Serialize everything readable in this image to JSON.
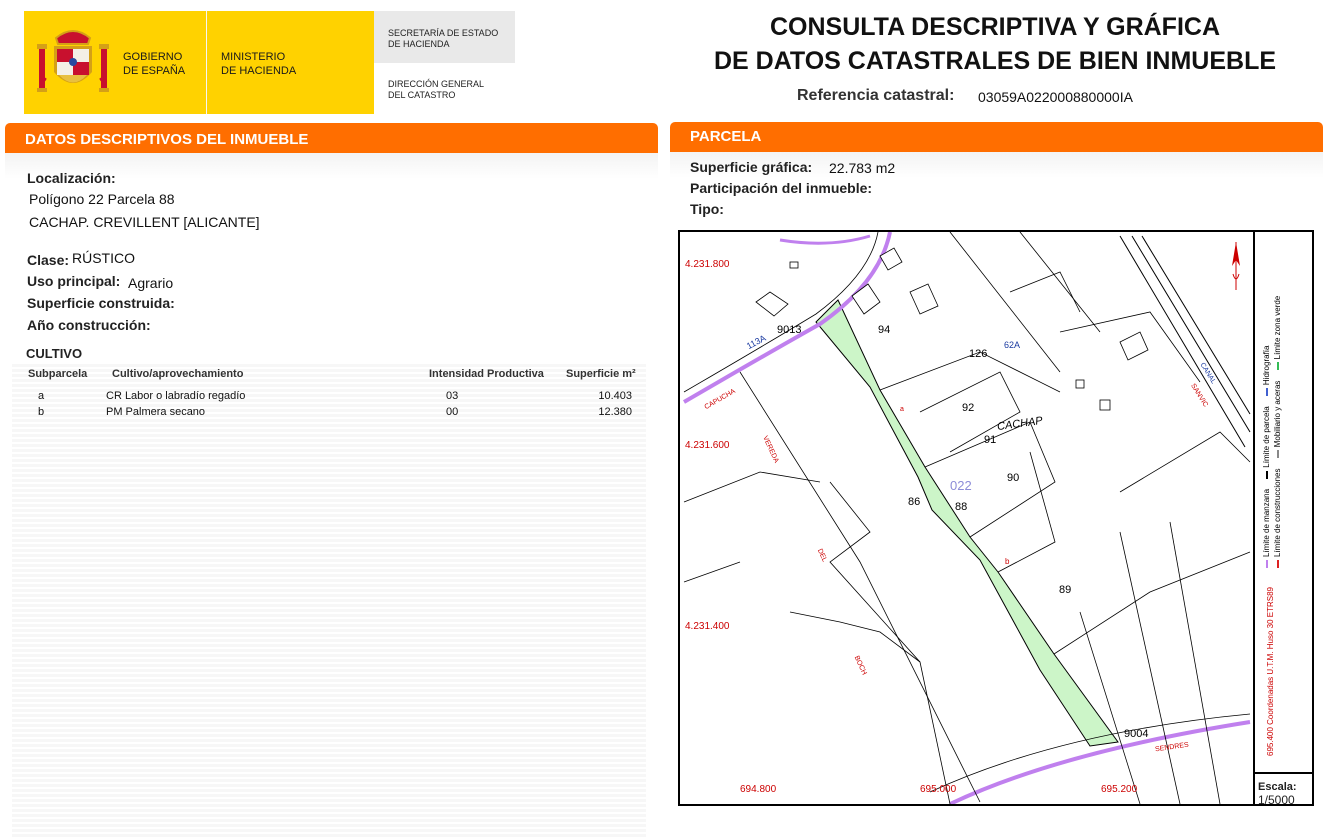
{
  "header": {
    "gobierno": [
      "GOBIERNO",
      "DE ESPAÑA"
    ],
    "ministerio": [
      "MINISTERIO",
      "DE HACIENDA"
    ],
    "secretaria": [
      "SECRETARÍA DE ESTADO",
      "DE HACIENDA"
    ],
    "direccion": [
      "DIRECCIÓN GENERAL",
      "DEL CATASTRO"
    ],
    "title_line1": "CONSULTA DESCRIPTIVA Y GRÁFICA",
    "title_line2": "DE DATOS CATASTRALES DE BIEN INMUEBLE",
    "ref_label": "Referencia catastral:",
    "ref_value": "03059A022000880000IA"
  },
  "colors": {
    "brand_yellow": "#ffd200",
    "accent_orange": "#ff6e00",
    "parcel_green": "#ccf5c8",
    "boundary_purple": "#c080ee"
  },
  "descriptive": {
    "section_title": "DATOS DESCRIPTIVOS DEL INMUEBLE",
    "localizacion_label": "Localización:",
    "localizacion_line1": "Polígono 22 Parcela 88",
    "localizacion_line2": "CACHAP. CREVILLENT [ALICANTE]",
    "clase_label": "Clase:",
    "clase_value": "RÚSTICO",
    "uso_label": "Uso principal:",
    "uso_value": "Agrario",
    "superficie_label": "Superficie construida:",
    "anio_label": "Año construcción:"
  },
  "cultivo": {
    "title": "CULTIVO",
    "headers": [
      "Subparcela",
      "Cultivo/aprovechamiento",
      "Intensidad Productiva",
      "Superficie m²"
    ],
    "rows": [
      {
        "sub": "a",
        "cultivo": "CR Labor o labradío regadío",
        "intensidad": "03",
        "superficie": "10.403"
      },
      {
        "sub": "b",
        "cultivo": "PM Palmera secano",
        "intensidad": "00",
        "superficie": "12.380"
      }
    ]
  },
  "parcela": {
    "section_title": "PARCELA",
    "superficie_label": "Superficie gráfica:",
    "superficie_value": "22.783 m2",
    "participacion_label": "Participación del inmueble:",
    "tipo_label": "Tipo:"
  },
  "map": {
    "y_ticks": [
      "4.231.800",
      "4.231.600",
      "4.231.400"
    ],
    "x_ticks": [
      "694.800",
      "695.000",
      "695.200"
    ],
    "parcel_labels": [
      "9013",
      "94",
      "126",
      "92",
      "91",
      "90",
      "86",
      "88",
      "89",
      "9004"
    ],
    "polygon_label": "022",
    "subparcel_labels": [
      "a",
      "b"
    ],
    "place_name": "CACHAP",
    "blue_labels": [
      "113A",
      "62A"
    ],
    "road_labels": [
      "CANAL",
      "SANVIC",
      "CAPUCHA",
      "VEREDA",
      "DEL",
      "BOCH",
      "SENDRES"
    ],
    "coord_note": "695.400 Coordenadas U.T.M. Huso 30 ETRS89",
    "legend": [
      {
        "label": "Límite de manzana",
        "color": "#c080ee"
      },
      {
        "label": "Límite de parcela",
        "color": "#000000"
      },
      {
        "label": "Hidrografía",
        "color": "#4060d0"
      },
      {
        "label": "Límite de construcciones",
        "color": "#dd2222"
      },
      {
        "label": "Mobiliario y aceras",
        "color": "#888888"
      },
      {
        "label": "Límite zona verde",
        "color": "#33bb55"
      }
    ],
    "scale_label": "Escala:",
    "scale_value": "1/5000"
  }
}
